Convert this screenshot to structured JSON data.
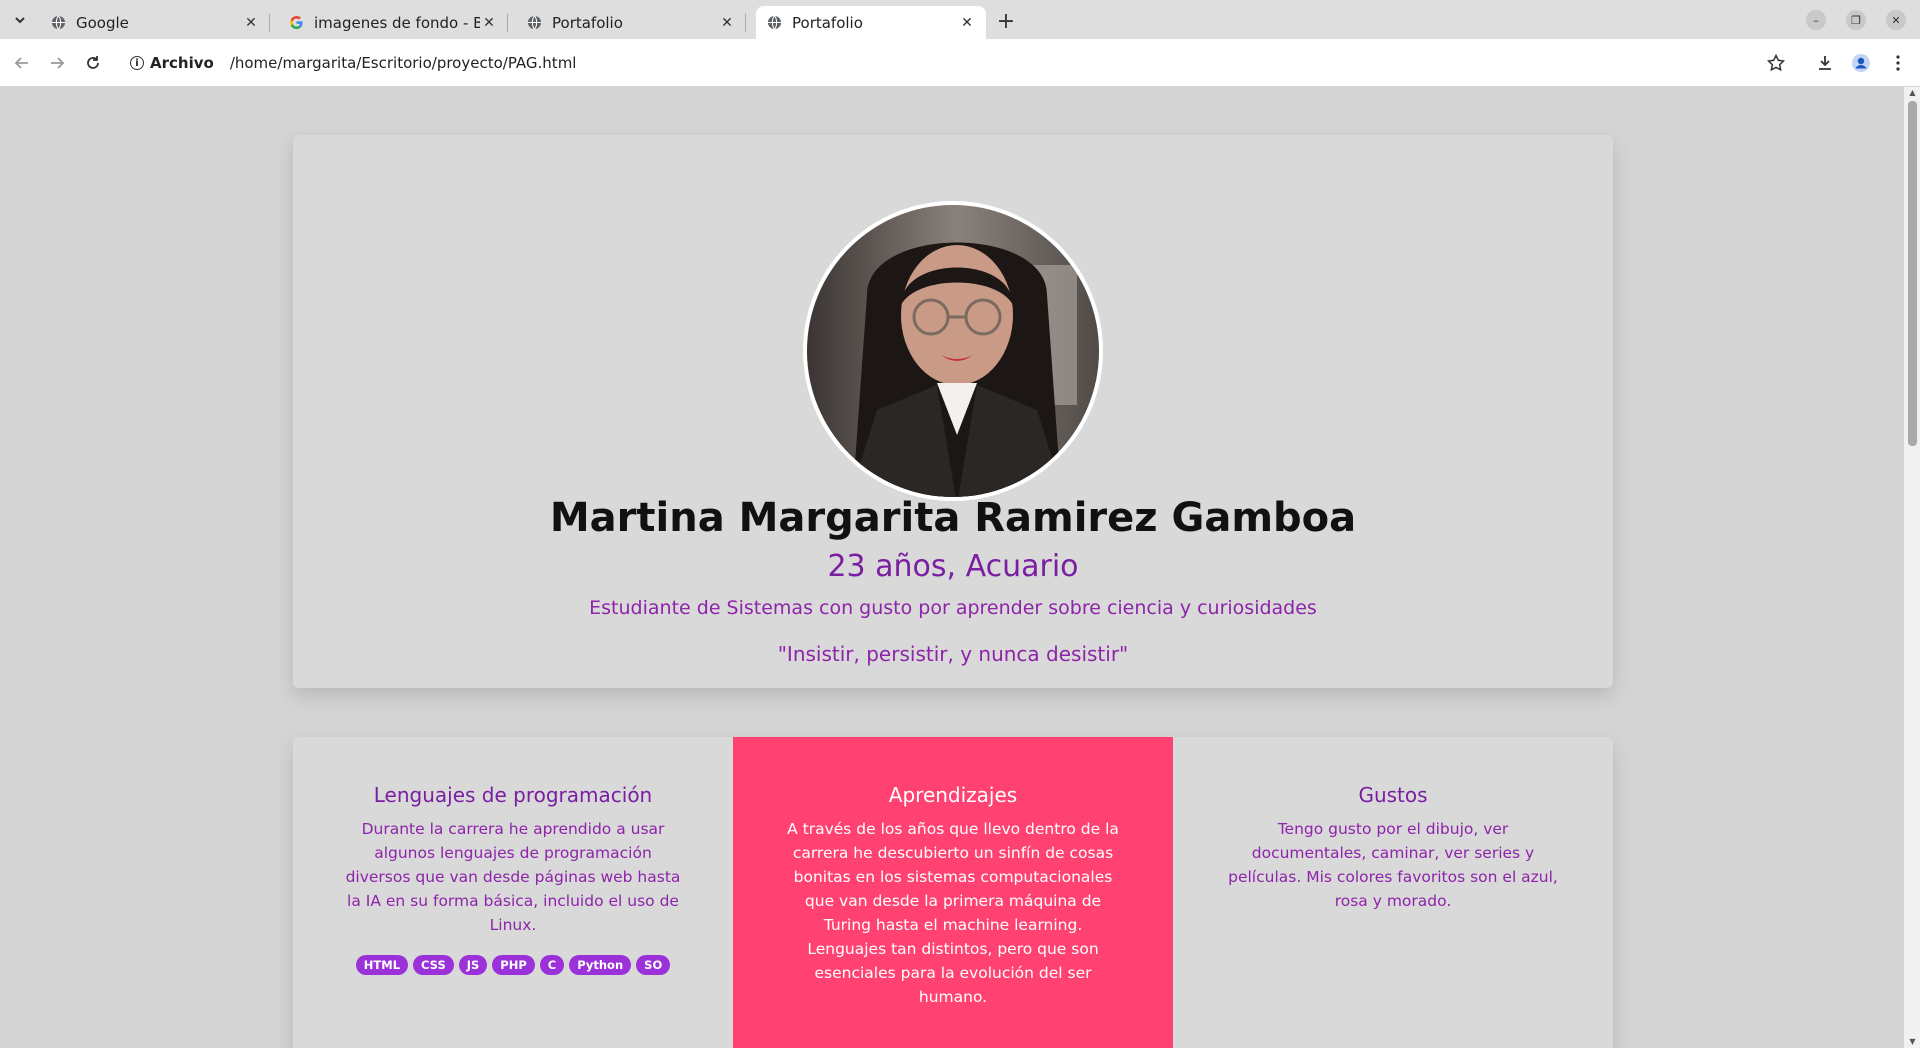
{
  "browser": {
    "tabs": [
      {
        "title": "Google",
        "favicon": "globe-icon",
        "active": false
      },
      {
        "title": "imagenes de fondo - Bus",
        "favicon": "google-g-icon",
        "active": false
      },
      {
        "title": "Portafolio",
        "favicon": "globe-icon",
        "active": false
      },
      {
        "title": "Portafolio",
        "favicon": "globe-icon",
        "active": true
      }
    ],
    "site_info_label": "Archivo",
    "url": "/home/margarita/Escritorio/proyecto/PAG.html"
  },
  "profile": {
    "name": "Martina Margarita Ramirez Gamboa",
    "age_sign": "23 años, Acuario",
    "tagline": "Estudiante de Sistemas con gusto por aprender sobre ciencia y curiosidades",
    "quote": "\"Insistir, persistir, y nunca desistir\""
  },
  "cards": [
    {
      "title": "Lenguajes de programación",
      "text": "Durante la carrera he aprendido a usar algunos lenguajes de programación diversos que van desde páginas web hasta la IA en su forma básica, incluido el uso de Linux.",
      "badges": [
        "HTML",
        "CSS",
        "JS",
        "PHP",
        "C",
        "Python",
        "SO"
      ]
    },
    {
      "title": "Aprendizajes",
      "text": "A través de los años que llevo dentro de la carrera he descubierto un sinfín de cosas bonitas en los sistemas computacionales que van desde la primera máquina de Turing hasta el machine learning. Lenguajes tan distintos, pero que son esenciales para la evolución del ser humano."
    },
    {
      "title": "Gustos",
      "text": "Tengo gusto por el dibujo, ver documentales, caminar, ver series y películas. Mis colores favoritos son el azul, rosa y morado."
    }
  ],
  "colors": {
    "accent_purple": "#7b1fa2",
    "accent_pink": "#ff4272",
    "badge_purple": "#9b32d9",
    "page_bg": "#d4d4d4"
  }
}
